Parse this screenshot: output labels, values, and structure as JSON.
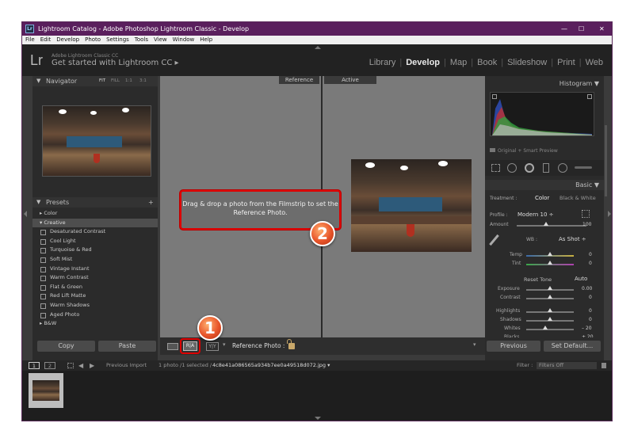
{
  "window": {
    "title": "Lightroom Catalog - Adobe Photoshop Lightroom Classic - Develop",
    "app_icon_text": "Lr",
    "controls": {
      "minimize": "—",
      "maximize": "☐",
      "close": "✕"
    }
  },
  "menu": [
    "File",
    "Edit",
    "Develop",
    "Photo",
    "Settings",
    "Tools",
    "View",
    "Window",
    "Help"
  ],
  "identity": {
    "logo": "Lr",
    "small": "Adobe Lightroom Classic CC",
    "big": "Get started with Lightroom CC ▸"
  },
  "modules": [
    "Library",
    "Develop",
    "Map",
    "Book",
    "Slideshow",
    "Print",
    "Web"
  ],
  "modules_active": "Develop",
  "navigator": {
    "title": "Navigator",
    "zoom_options": [
      "FIT",
      "FILL",
      "1:1",
      "3:1"
    ]
  },
  "presets": {
    "title": "Presets",
    "add": "+",
    "groups": [
      {
        "label": "Color",
        "open": false
      },
      {
        "label": "Creative",
        "open": true
      }
    ],
    "items": [
      "Desaturated Contrast",
      "Cool Light",
      "Turquoise & Red",
      "Soft Mist",
      "Vintage Instant",
      "Warm Contrast",
      "Flat & Green",
      "Red Lift Matte",
      "Warm Shadows",
      "Aged Photo"
    ],
    "after_group": "B&W"
  },
  "left_buttons": {
    "copy": "Copy",
    "paste": "Paste"
  },
  "compare": {
    "reference_label": "Reference",
    "active_label": "Active",
    "drop_hint": "Drag & drop a photo from the Filmstrip to set the Reference Photo."
  },
  "toolbar": {
    "reference_photo_label": "Reference Photo :",
    "view_ra": "R|A",
    "view_yy": "Y|Y"
  },
  "callouts": {
    "one": "1",
    "two": "2"
  },
  "histogram": {
    "title": "Histogram",
    "preview_label": "Original + Smart Preview"
  },
  "basic": {
    "title": "Basic",
    "treatment_label": "Treatment :",
    "treatment_color": "Color",
    "treatment_bw": "Black & White",
    "profile_label": "Profile :",
    "profile_value": "Modern 10 ÷",
    "amount_label": "Amount",
    "amount_value": "100",
    "wb_label": "WB :",
    "wb_value": "As Shot ÷",
    "temp_label": "Temp",
    "temp_value": "0",
    "tint_label": "Tint",
    "tint_value": "0",
    "reset_tone": "Reset Tone",
    "auto": "Auto",
    "exposure_label": "Exposure",
    "exposure_value": "0.00",
    "contrast_label": "Contrast",
    "contrast_value": "0",
    "highlights_label": "Highlights",
    "highlights_value": "0",
    "shadows_label": "Shadows",
    "shadows_value": "0",
    "whites_label": "Whites",
    "whites_value": "– 20",
    "blacks_label": "Blacks",
    "blacks_value": "+ 20"
  },
  "right_buttons": {
    "previous": "Previous",
    "set_default": "Set Default..."
  },
  "filmstrip": {
    "screen1": "1",
    "screen2": "2",
    "source": "Previous Import",
    "info_count": "1 photo /1 selected /",
    "filename": "4c8e41a086565a934b7ee0a49518d072.jpg ▾",
    "filter_label": "Filter :",
    "filter_value": "Filters Off"
  },
  "colors": {
    "title_bar": "#5a1f5d",
    "callout": "#e8552a",
    "highlight": "#dd0000"
  }
}
